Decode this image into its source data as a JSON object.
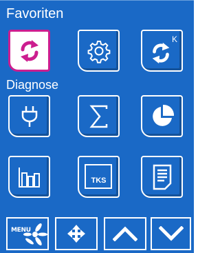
{
  "sections": {
    "favorites": "Favoriten",
    "diagnosis": "Diagnose"
  },
  "favorites": [
    {
      "icon": "refresh-icon",
      "selected": true
    },
    {
      "icon": "gear-icon",
      "selected": false
    },
    {
      "icon": "refresh-k-icon",
      "superscript": "K",
      "selected": false
    }
  ],
  "diagnosis": [
    {
      "icon": "plug-icon"
    },
    {
      "icon": "sigma-icon"
    },
    {
      "icon": "pie-chart-icon"
    },
    {
      "icon": "bar-chart-icon"
    },
    {
      "icon": "tks-icon",
      "label": "TKS"
    },
    {
      "icon": "document-icon"
    }
  ],
  "bottom_bar": {
    "menu_label": "MENU",
    "buttons": [
      "menu-icon",
      "move-icon",
      "chevron-up-icon",
      "chevron-down-icon"
    ]
  },
  "colors": {
    "background": "#1a69c6",
    "selected_border": "#cc1e8f",
    "icon_selected": "#cc1e8f",
    "foreground": "#ffffff"
  }
}
